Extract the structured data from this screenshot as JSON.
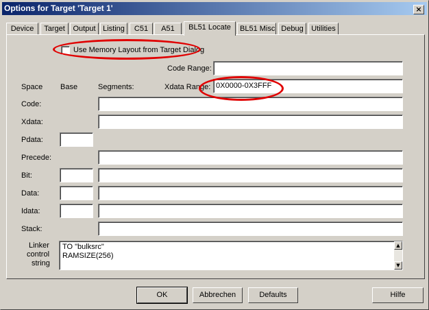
{
  "window": {
    "title": "Options for Target 'Target 1'",
    "close_glyph": "×"
  },
  "tabs": [
    "Device",
    "Target",
    "Output",
    "Listing",
    "C51",
    "A51",
    "BL51 Locate",
    "BL51 Misc",
    "Debug",
    "Utilities"
  ],
  "active_tab": "BL51 Locate",
  "memory_layout_checkbox": {
    "label": "Use Memory Layout from Target Dialog",
    "checked": false
  },
  "code_range": {
    "label": "Code Range:",
    "value": ""
  },
  "xdata_range": {
    "label": "Xdata Range:",
    "value": "0X0000-0X3FFF"
  },
  "columns": {
    "space": "Space",
    "base": "Base",
    "segments": "Segments:"
  },
  "rows": {
    "code": {
      "label": "Code:"
    },
    "xdata": {
      "label": "Xdata:"
    },
    "pdata": {
      "label": "Pdata:"
    },
    "precede": {
      "label": "Precede:"
    },
    "bit": {
      "label": "Bit:"
    },
    "data": {
      "label": "Data:"
    },
    "idata": {
      "label": "Idata:"
    },
    "stack": {
      "label": "Stack:"
    }
  },
  "linker": {
    "label_1": "Linker",
    "label_2": "control",
    "label_3": "string",
    "line_1": "TO \"bulksrc\"",
    "line_2": "RAMSIZE(256)"
  },
  "buttons": {
    "ok": "OK",
    "cancel": "Abbrechen",
    "defaults": "Defaults",
    "help": "Hilfe"
  },
  "highlight_color": "#e00000"
}
